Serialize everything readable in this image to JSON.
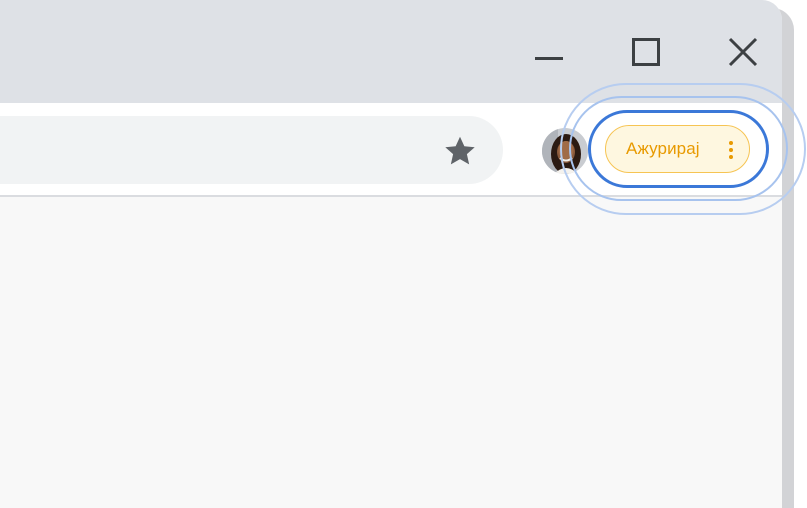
{
  "window_controls": {
    "minimize_icon": "minimize-icon",
    "maximize_icon": "maximize-icon",
    "close_icon": "close-icon"
  },
  "toolbar": {
    "bookmark_icon": "star-icon",
    "profile_avatar": "avatar",
    "update_button": {
      "label": "Ажурирај",
      "menu_icon": "kebab-menu-icon"
    }
  },
  "colors": {
    "title_bar": "#dee1e6",
    "toolbar": "#ffffff",
    "omnibox": "#f1f3f4",
    "content": "#f8f8f8",
    "update_text": "#e89a00",
    "update_fill": "#fef7e0",
    "update_border": "#f6c453",
    "highlight": "#3b78d8"
  }
}
